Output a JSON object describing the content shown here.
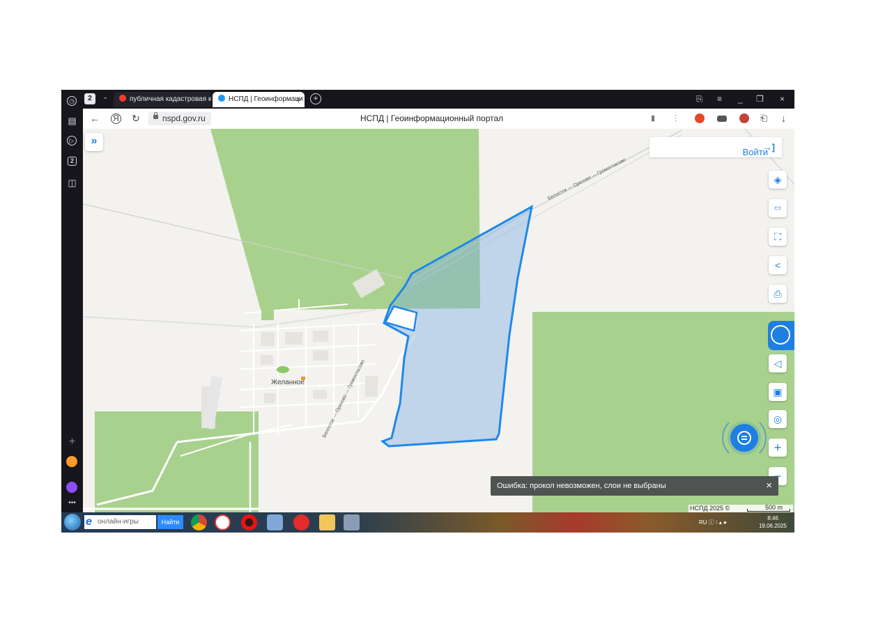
{
  "browser": {
    "tab_count_badge": "2",
    "tabs": [
      {
        "label": "публичная кадастровая к",
        "active": false,
        "favicon_color": "#ff3b30"
      },
      {
        "label": "НСПД | Геоинформаци",
        "active": true,
        "favicon_color": "#2196f3"
      }
    ],
    "url": "nspd.gov.ru",
    "page_title": "НСПД | Геоинформационный портал",
    "rail_badge": "2"
  },
  "map": {
    "collapse_label": "»",
    "login_label": "Войти",
    "village_name": "Желанное",
    "road_labels": [
      "Белосток — Орехово — Громогласово",
      "Белосток — Орехово — Громогласово"
    ],
    "tools": [
      "layers-icon",
      "ruler-icon",
      "select-area-icon",
      "share-icon",
      "print-icon",
      "nspd-logo-icon",
      "locate-icon",
      "frame-icon",
      "pin-search-icon",
      "zoom-in-icon"
    ],
    "zoom_in_label": "+",
    "zoom_out_label": "−",
    "error_toast": "Ошибка: прокол невозможен, слои не выбраны",
    "toast_close": "×",
    "attribution": "НСПД 2025 ©",
    "scale_label": "500 m",
    "colors": {
      "forest": "#a9d18e",
      "parcel_stroke": "#1f87ea",
      "parcel_fill": "#7aaee0",
      "accent": "#1f7fe0"
    }
  },
  "taskbar": {
    "search_placeholder": "онлайн-игры",
    "search_button": "Найти",
    "tray_lang": "RU",
    "time": "8:46",
    "date": "19.06.2025"
  }
}
